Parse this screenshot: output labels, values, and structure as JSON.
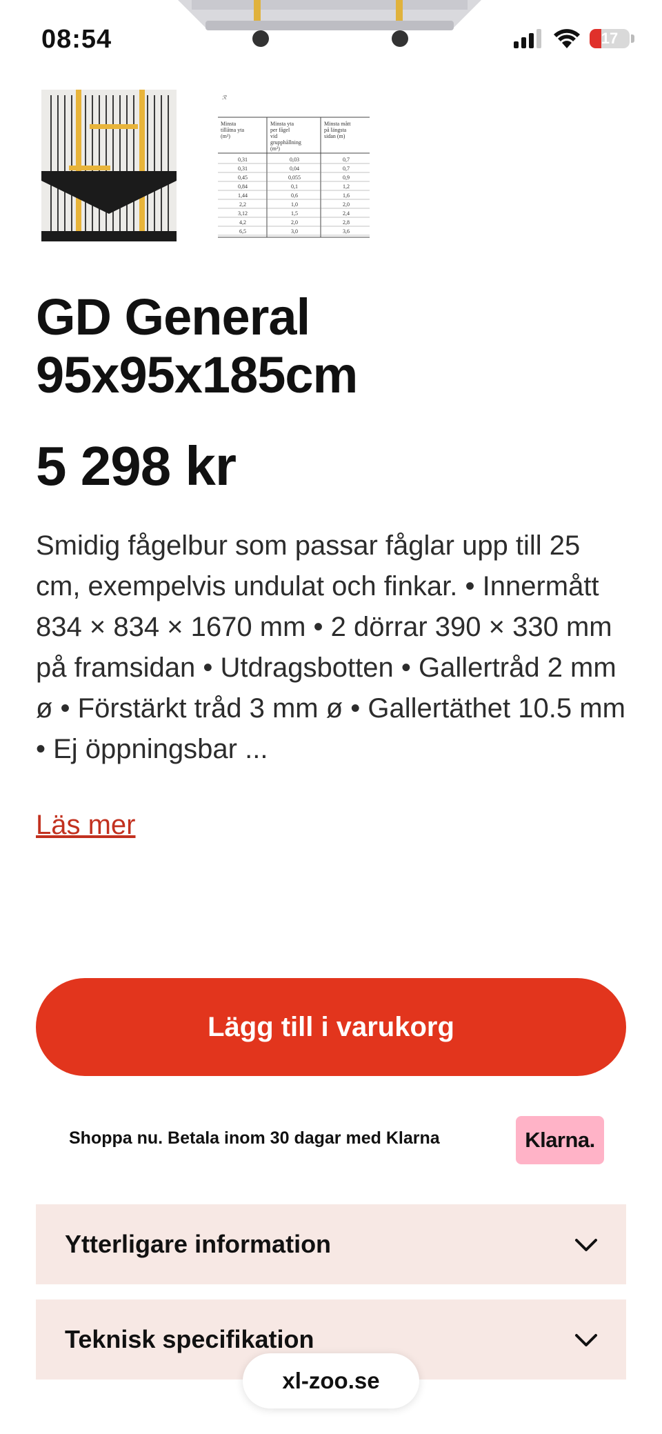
{
  "status_bar": {
    "time": "08:54",
    "battery": "17"
  },
  "product": {
    "title": "GD General 95x95x185cm",
    "price": "5 298 kr",
    "description": "Smidig fågelbur som passar fåglar upp till 25 cm, exempelvis undulat och finkar. • Innermått 834 × 834 × 1670 mm • 2 dörrar 390 × 330 mm på framsidan • Utdragsbotten • Gallertråd 2 mm ø • Förstärkt tråd 3 mm ø • Gallertäthet 10.5 mm • Ej öppningsbar ...",
    "read_more": "Läs mer"
  },
  "thumbnail_table": {
    "headers": [
      "Minsta tillåtna yta (m²)",
      "Minsta yta per fågel vid grupphållning (m²)",
      "Minsta mått på längsta sidan (m)"
    ],
    "rows": [
      [
        "0,31",
        "0,03",
        "0,7"
      ],
      [
        "0,31",
        "0,04",
        "0,7"
      ],
      [
        "0,45",
        "0,055",
        "0,9"
      ],
      [
        "0,84",
        "0,1",
        "1,2"
      ],
      [
        "1,44",
        "0,6",
        "1,6"
      ],
      [
        "2,2",
        "1,0",
        "2,0"
      ],
      [
        "3,12",
        "1,5",
        "2,4"
      ],
      [
        "4,2",
        "2,0",
        "2,8"
      ],
      [
        "6,5",
        "3,0",
        "3,6"
      ]
    ]
  },
  "cart": {
    "add_label": "Lägg till i varukorg"
  },
  "klarna": {
    "text": "Shoppa nu. Betala inom 30 dagar med Klarna",
    "badge": "Klarna."
  },
  "accordions": [
    {
      "label": "Ytterligare information"
    },
    {
      "label": "Teknisk specifikation"
    }
  ],
  "browser": {
    "url": "xl-zoo.se"
  },
  "colors": {
    "accent": "#e2351d",
    "accordion_bg": "#f7e8e4",
    "klarna_pink": "#ffb3c7",
    "link": "#c2311f"
  }
}
